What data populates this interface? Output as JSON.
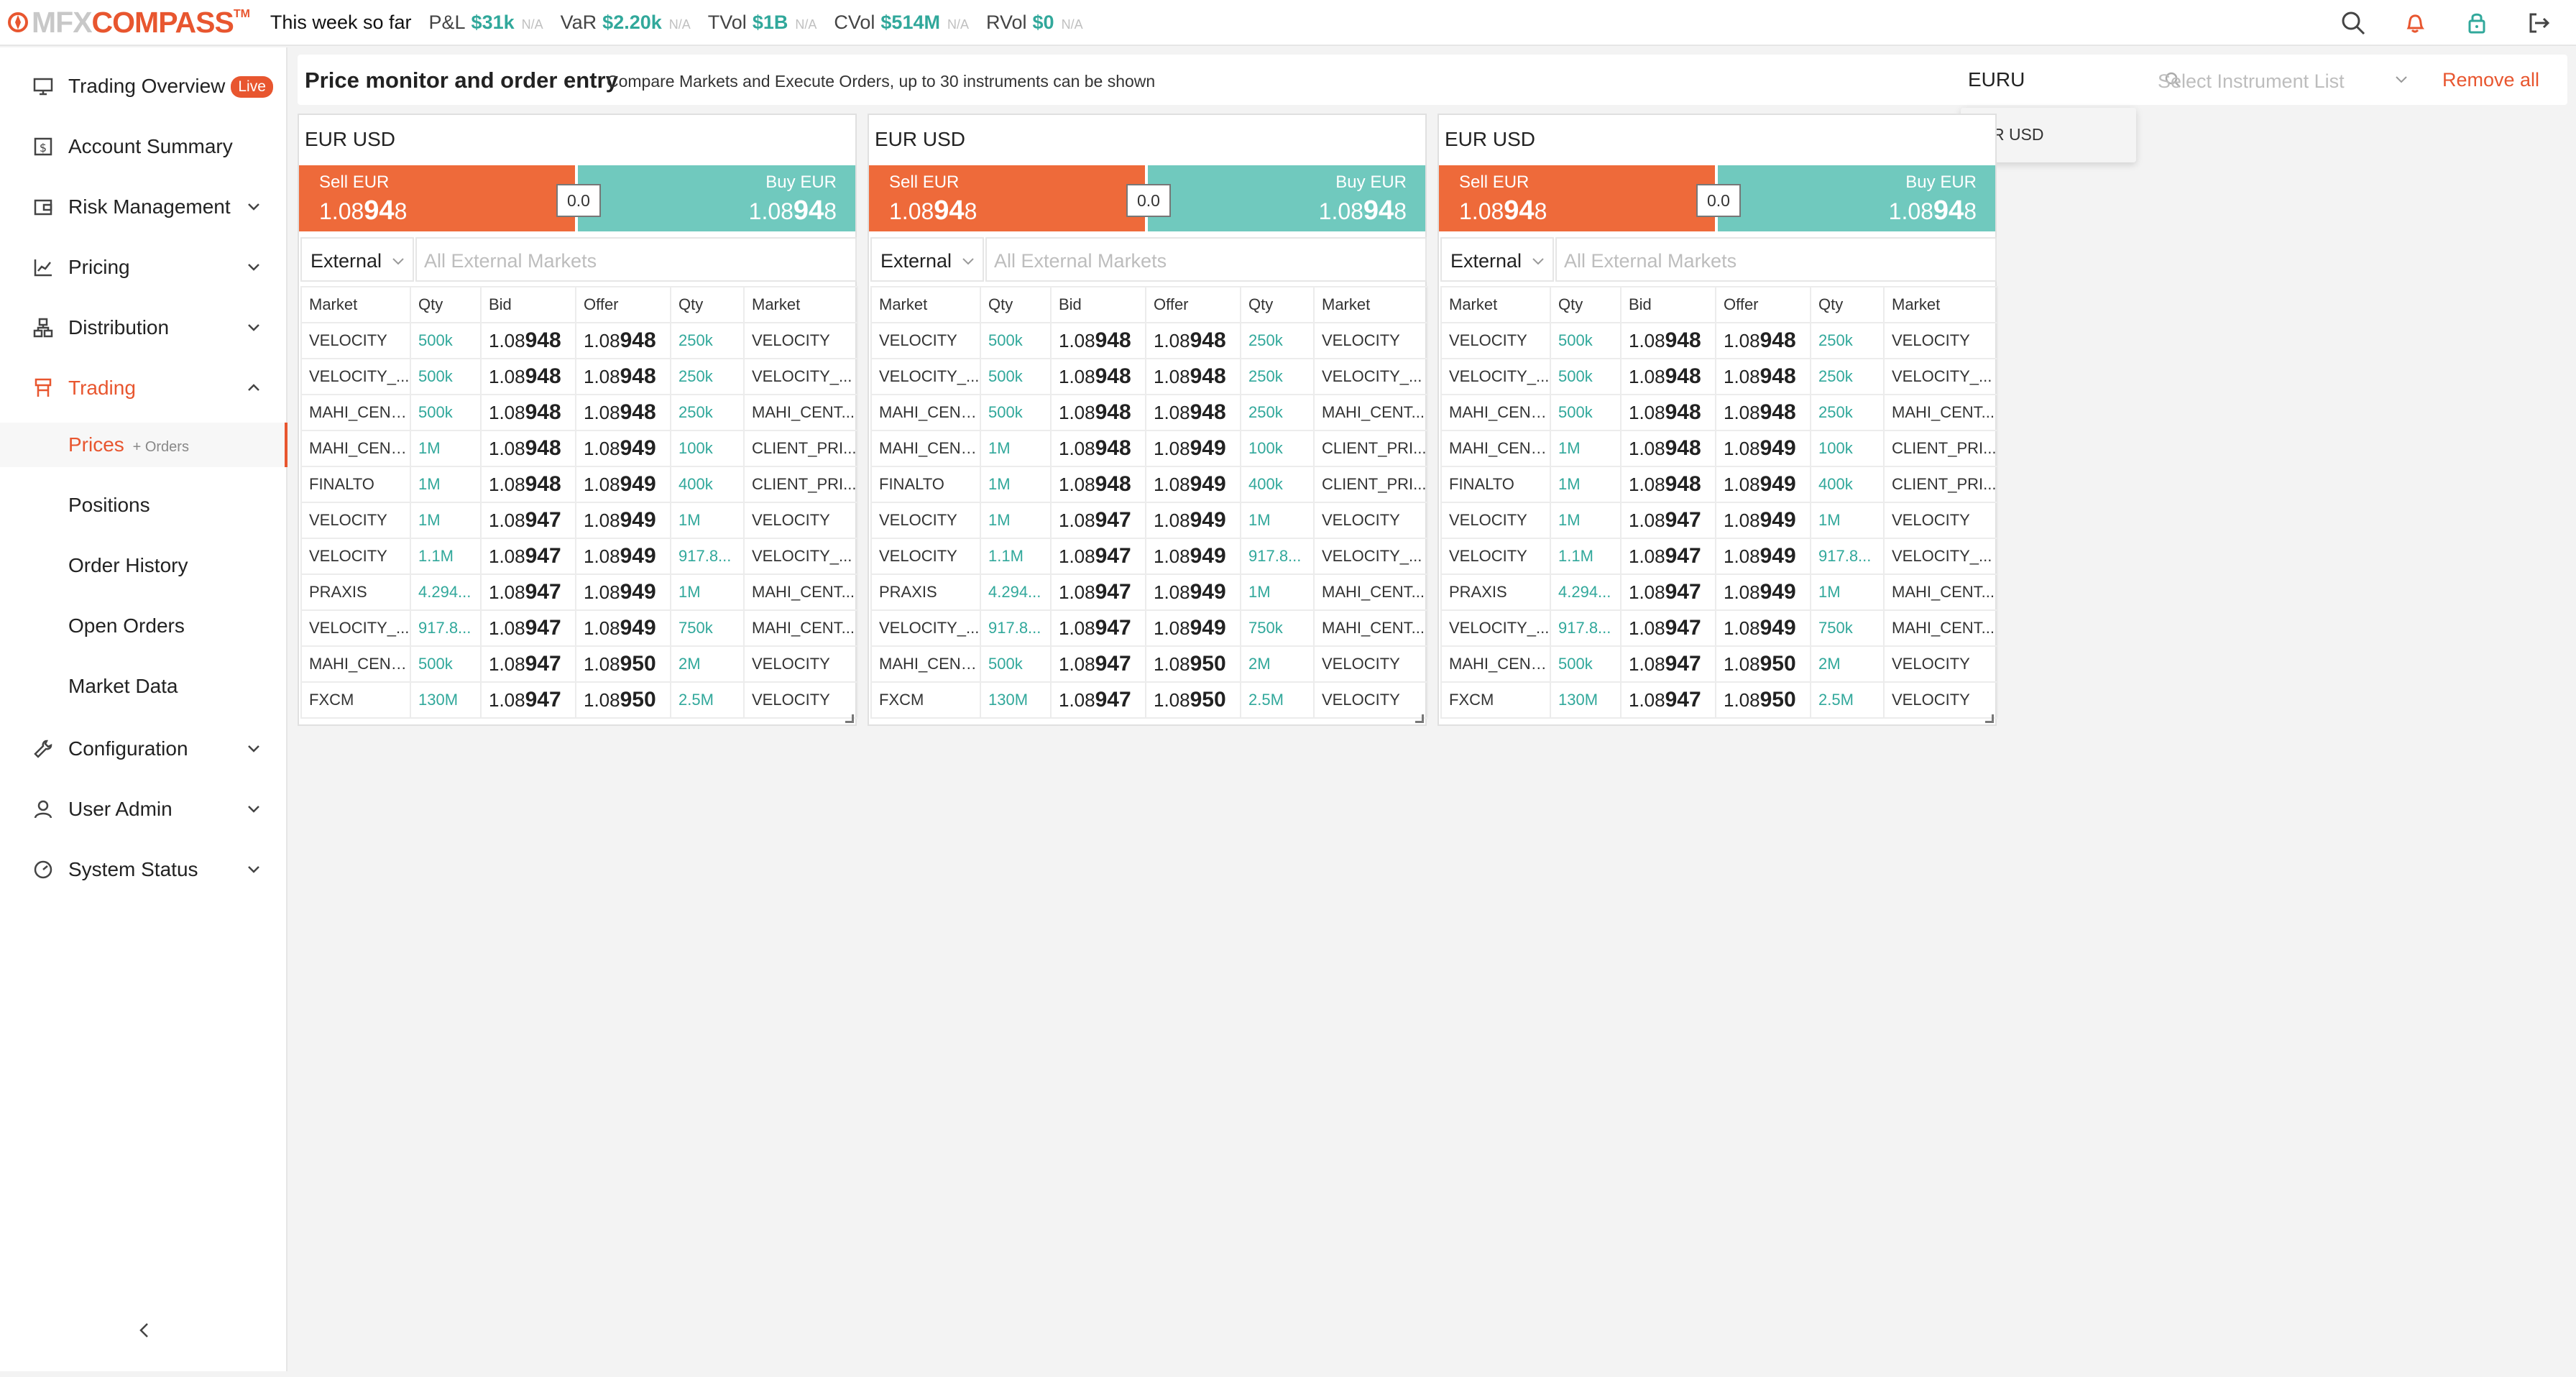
{
  "header": {
    "logo_mfx": "MFX",
    "logo_compass": "COMPASS",
    "logo_tm": "TM",
    "period": "This week so far",
    "metrics": [
      {
        "label": "P&L",
        "value": "$31k",
        "na": "N/A"
      },
      {
        "label": "VaR",
        "value": "$2.20k",
        "na": "N/A"
      },
      {
        "label": "TVol",
        "value": "$1B",
        "na": "N/A"
      },
      {
        "label": "CVol",
        "value": "$514M",
        "na": "N/A"
      },
      {
        "label": "RVol",
        "value": "$0",
        "na": "N/A"
      }
    ],
    "icons": [
      "search-icon",
      "notification-bell-icon",
      "lock-icon",
      "logout-icon"
    ]
  },
  "sidebar": {
    "items": [
      {
        "label": "Trading Overview",
        "badge": "Live",
        "icon": "monitor-icon"
      },
      {
        "label": "Account Summary",
        "icon": "calendar-dollar-icon"
      },
      {
        "label": "Risk Management",
        "icon": "wallet-icon"
      },
      {
        "label": "Pricing",
        "icon": "line-chart-icon"
      },
      {
        "label": "Distribution",
        "icon": "network-icon"
      },
      {
        "label": "Trading",
        "icon": "trading-icon"
      },
      {
        "label": "Configuration",
        "icon": "wrench-icon"
      },
      {
        "label": "User Admin",
        "icon": "user-icon"
      },
      {
        "label": "System Status",
        "icon": "gauge-icon"
      }
    ],
    "trading_sub": [
      {
        "label": "Prices",
        "suffix": "+ Orders"
      },
      {
        "label": "Positions"
      },
      {
        "label": "Order History"
      },
      {
        "label": "Open Orders"
      },
      {
        "label": "Market Data"
      }
    ]
  },
  "main": {
    "title": "Price monitor and order entry",
    "description": "Compare Markets and Execute Orders, up to 30 instruments can be shown",
    "search_value": "EURU",
    "instrument_list_placeholder": "Select Instrument List",
    "remove_all": "Remove all",
    "dropdown_option": "EUR USD"
  },
  "panel": {
    "title": "EUR USD",
    "sell_label": "Sell EUR",
    "buy_label": "Buy EUR",
    "price_prefix": "1.08",
    "price_pips": "94",
    "price_last": "8",
    "spread": "0.0",
    "external_label": "External",
    "markets_placeholder": "All External Markets",
    "columns": [
      "Market",
      "Qty",
      "Bid",
      "Offer",
      "Qty",
      "Market"
    ],
    "rows": [
      [
        "VELOCITY",
        "500k",
        "1.08948",
        "1.08948",
        "250k",
        "VELOCITY"
      ],
      [
        "VELOCITY_...",
        "500k",
        "1.08948",
        "1.08948",
        "250k",
        "VELOCITY_..."
      ],
      [
        "MAHI_CENT...",
        "500k",
        "1.08948",
        "1.08948",
        "250k",
        "MAHI_CENT..."
      ],
      [
        "MAHI_CENT...",
        "1M",
        "1.08948",
        "1.08949",
        "100k",
        "CLIENT_PRI..."
      ],
      [
        "FINALTO",
        "1M",
        "1.08948",
        "1.08949",
        "400k",
        "CLIENT_PRI..."
      ],
      [
        "VELOCITY",
        "1M",
        "1.08947",
        "1.08949",
        "1M",
        "VELOCITY"
      ],
      [
        "VELOCITY",
        "1.1M",
        "1.08947",
        "1.08949",
        "917.8...",
        "VELOCITY_..."
      ],
      [
        "PRAXIS",
        "4.294...",
        "1.08947",
        "1.08949",
        "1M",
        "MAHI_CENT..."
      ],
      [
        "VELOCITY_...",
        "917.8...",
        "1.08947",
        "1.08949",
        "750k",
        "MAHI_CENT..."
      ],
      [
        "MAHI_CENT...",
        "500k",
        "1.08947",
        "1.08950",
        "2M",
        "VELOCITY"
      ],
      [
        "FXCM",
        "130M",
        "1.08947",
        "1.08950",
        "2.5M",
        "VELOCITY"
      ]
    ]
  },
  "colors": {
    "accent": "#e8562f",
    "sell": "#ee6a3a",
    "buy": "#70c9be",
    "qty": "#31a89b"
  }
}
